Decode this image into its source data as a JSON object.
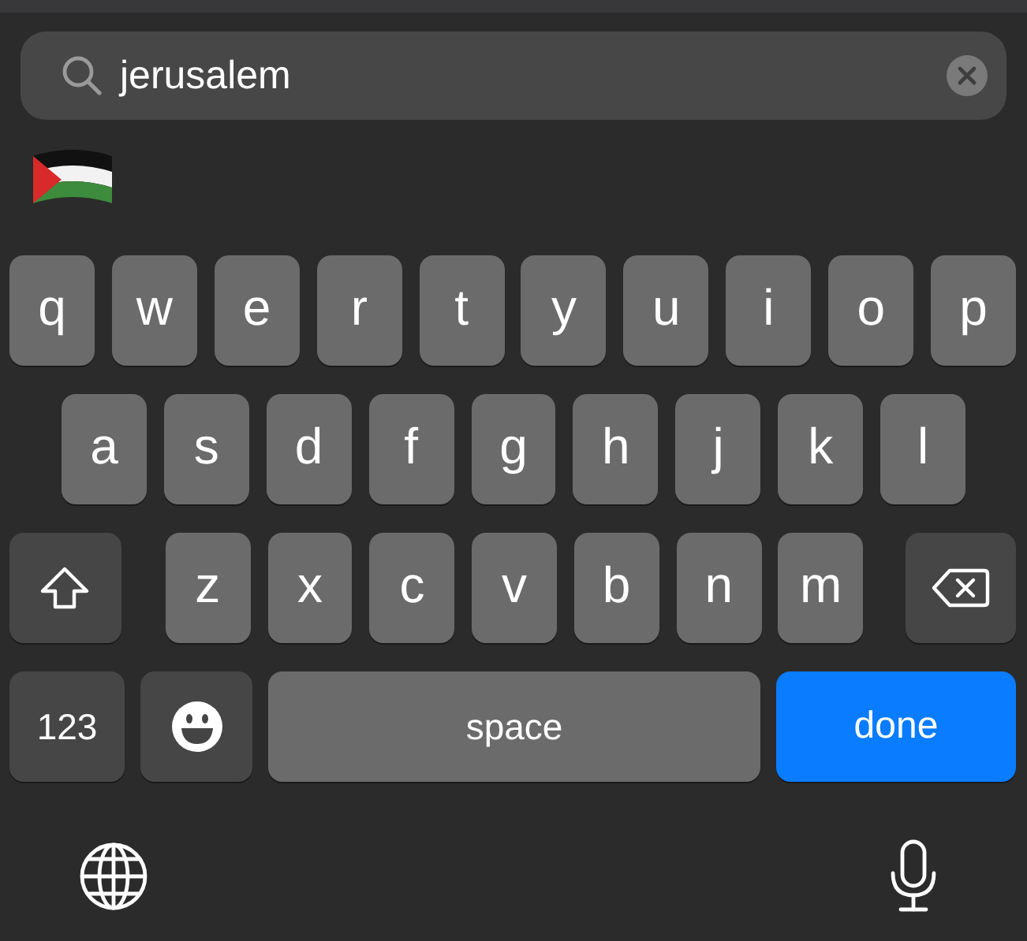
{
  "search": {
    "value": "jerusalem",
    "clear_button": true
  },
  "emoji_results": [
    {
      "kind": "flag"
    }
  ],
  "keyboard": {
    "rows": [
      {
        "keys": [
          {
            "kind": "letter",
            "label": "q"
          },
          {
            "kind": "letter",
            "label": "w"
          },
          {
            "kind": "letter",
            "label": "e"
          },
          {
            "kind": "letter",
            "label": "r"
          },
          {
            "kind": "letter",
            "label": "t"
          },
          {
            "kind": "letter",
            "label": "y"
          },
          {
            "kind": "letter",
            "label": "u"
          },
          {
            "kind": "letter",
            "label": "i"
          },
          {
            "kind": "letter",
            "label": "o"
          },
          {
            "kind": "letter",
            "label": "p"
          }
        ]
      },
      {
        "keys": [
          {
            "kind": "letter",
            "label": "a"
          },
          {
            "kind": "letter",
            "label": "s"
          },
          {
            "kind": "letter",
            "label": "d"
          },
          {
            "kind": "letter",
            "label": "f"
          },
          {
            "kind": "letter",
            "label": "g"
          },
          {
            "kind": "letter",
            "label": "h"
          },
          {
            "kind": "letter",
            "label": "j"
          },
          {
            "kind": "letter",
            "label": "k"
          },
          {
            "kind": "letter",
            "label": "l"
          }
        ]
      },
      {
        "keys": [
          {
            "kind": "shift",
            "on": false
          },
          {
            "kind": "letter",
            "label": "z"
          },
          {
            "kind": "letter",
            "label": "x"
          },
          {
            "kind": "letter",
            "label": "c"
          },
          {
            "kind": "letter",
            "label": "v"
          },
          {
            "kind": "letter",
            "label": "b"
          },
          {
            "kind": "letter",
            "label": "n"
          },
          {
            "kind": "letter",
            "label": "m"
          },
          {
            "kind": "delete"
          }
        ]
      },
      {
        "keys": [
          {
            "kind": "numbers",
            "label": "123"
          },
          {
            "kind": "emoji"
          },
          {
            "kind": "space",
            "label": "space"
          },
          {
            "kind": "return",
            "label": "done"
          }
        ]
      }
    ],
    "bottom": [
      {
        "kind": "globe"
      },
      {
        "kind": "mic"
      }
    ]
  }
}
